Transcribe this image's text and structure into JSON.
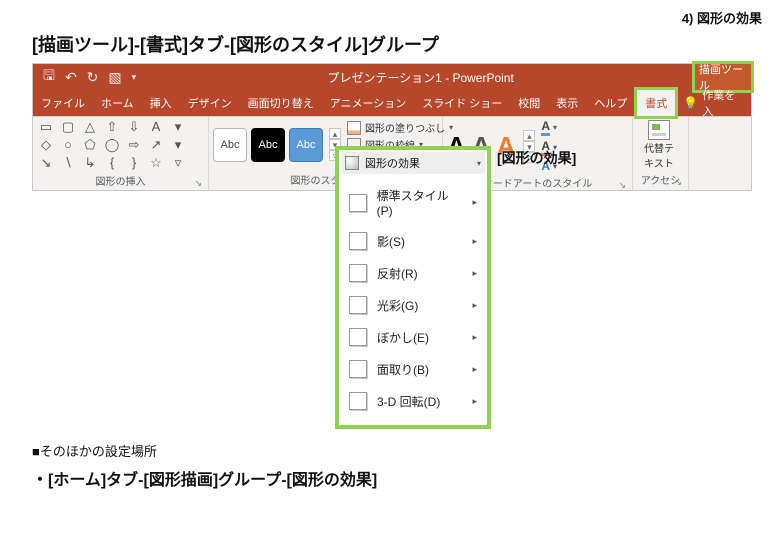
{
  "page": {
    "top_right_label": "4) 図形の効果",
    "title": "[描画ツール]-[書式]タブ-[図形のスタイル]グループ"
  },
  "ppt": {
    "title": "プレゼンテーション1  -  PowerPoint",
    "context_tab_header": "描画ツール",
    "tabs": {
      "file": "ファイル",
      "home": "ホーム",
      "insert": "挿入",
      "design": "デザイン",
      "transitions": "画面切り替え",
      "animations": "アニメーション",
      "slideshow": "スライド ショー",
      "review": "校閲",
      "view": "表示",
      "help": "ヘルプ",
      "format": "書式",
      "tellme": "作業を入"
    },
    "groups": {
      "shapes_insert": "図形の挿入",
      "shape_styles": "図形のスタイル",
      "wordart_styles": "ワードアートのスタイル",
      "accessibility": "アクセシ"
    },
    "style_chip_label": "Abc",
    "shape_fill": "図形の塗りつぶし",
    "shape_outline": "図形の枠線",
    "shape_effects": "図形の効果",
    "alt_text": "代替テ\nキスト"
  },
  "fx": {
    "header": "図形の効果",
    "callout": "[図形の効果]",
    "items": [
      {
        "label": "標準スタイル(P)"
      },
      {
        "label": "影(S)"
      },
      {
        "label": "反射(R)"
      },
      {
        "label": "光彩(G)"
      },
      {
        "label": "ぼかし(E)"
      },
      {
        "label": "面取り(B)"
      },
      {
        "label": "3-D 回転(D)"
      }
    ]
  },
  "doc_body": {
    "other_heading": "■そのほかの設定場所",
    "other_line": "・[ホーム]タブ-[図形描画]グループ-[図形の効果]"
  }
}
